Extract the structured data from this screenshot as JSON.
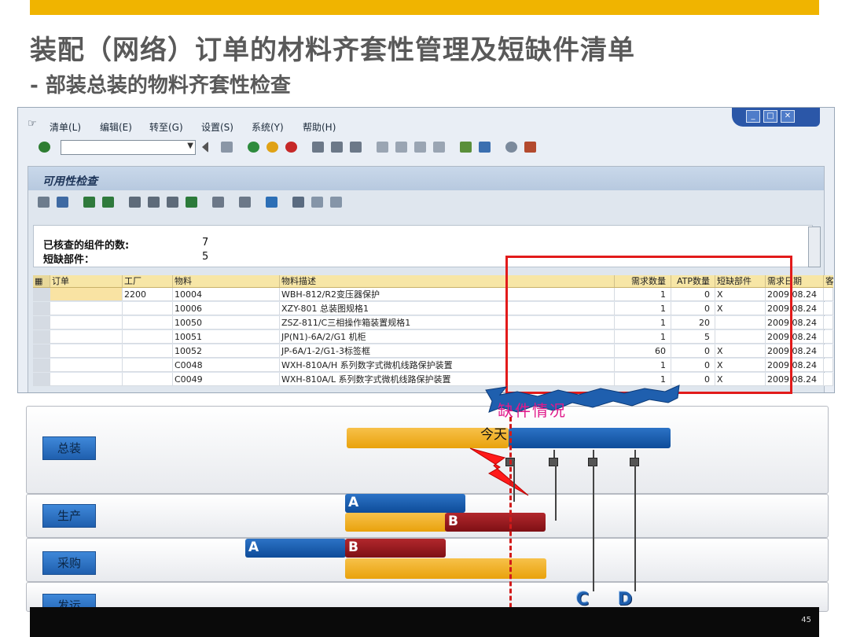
{
  "slide": {
    "title": "装配（网络）订单的材料齐套性管理及短缺件清单",
    "subtitle": "- 部装总装的物料齐套性检查",
    "page_number": "45"
  },
  "sap": {
    "menu": [
      "清单(L)",
      "编辑(E)",
      "转至(G)",
      "设置(S)",
      "系统(Y)",
      "帮助(H)"
    ],
    "panel_title": "可用性检查",
    "info": {
      "checked_label": "已核查的组件的数:",
      "checked_value": "7",
      "short_label": "短缺部件：",
      "short_value": "5"
    },
    "columns": [
      "订单",
      "工厂",
      "物料",
      "物料描述",
      "需求数量",
      "ATP数量",
      "短缺部件",
      "需求日期",
      "客户"
    ],
    "rows": [
      {
        "order": "",
        "plant": "2200",
        "material": "10004",
        "desc": "WBH-812/R2变压器保护",
        "qty": "1",
        "atp": "0",
        "short": "X",
        "date": "2009.08.24"
      },
      {
        "order": "",
        "plant": "",
        "material": "10006",
        "desc": "XZY-801 总装图规格1",
        "qty": "1",
        "atp": "0",
        "short": "X",
        "date": "2009.08.24"
      },
      {
        "order": "",
        "plant": "",
        "material": "10050",
        "desc": "ZSZ-811/C三相操作箱装置规格1",
        "qty": "1",
        "atp": "20",
        "short": "",
        "date": "2009.08.24"
      },
      {
        "order": "",
        "plant": "",
        "material": "10051",
        "desc": "JP(N1)-6A/2/G1 机柜",
        "qty": "1",
        "atp": "5",
        "short": "",
        "date": "2009.08.24"
      },
      {
        "order": "",
        "plant": "",
        "material": "10052",
        "desc": "JP-6A/1-2/G1-3标签框",
        "qty": "60",
        "atp": "0",
        "short": "X",
        "date": "2009.08.24"
      },
      {
        "order": "",
        "plant": "",
        "material": "C0048",
        "desc": "WXH-810A/H 系列数字式微机线路保护装置",
        "qty": "1",
        "atp": "0",
        "short": "X",
        "date": "2009.08.24"
      },
      {
        "order": "",
        "plant": "",
        "material": "C0049",
        "desc": "WXH-810A/L 系列数字式微机线路保护装置",
        "qty": "1",
        "atp": "0",
        "short": "X",
        "date": "2009.08.24"
      }
    ]
  },
  "diagram": {
    "shortage_label": "缺件情况",
    "today_label": "今天",
    "lanes": [
      "总装",
      "生产",
      "采购",
      "发运"
    ],
    "bar_labels": {
      "a": "A",
      "b": "B",
      "c": "C",
      "d": "D"
    }
  },
  "colors": {
    "accent": "#f0b400",
    "highlight": "#e21b1b",
    "bar_blue": "#1f5fae",
    "bar_orange": "#eeae20",
    "bar_red": "#9a1a20"
  }
}
